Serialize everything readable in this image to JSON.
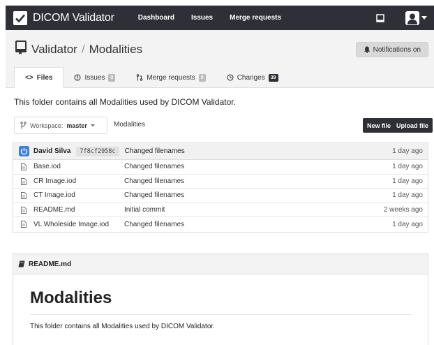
{
  "navbar": {
    "brand": "DICOM Validator",
    "links": [
      "Dashboard",
      "Issues",
      "Merge requests"
    ]
  },
  "header": {
    "breadcrumb": [
      "Validator",
      "Modalities"
    ],
    "separator": "/",
    "notifications_label": "Notifications on"
  },
  "tabs": [
    {
      "label": "Files",
      "count": "",
      "active": true
    },
    {
      "label": "Issues",
      "count": "0"
    },
    {
      "label": "Merge requests",
      "count": "0"
    },
    {
      "label": "Changes",
      "count": "39"
    }
  ],
  "folder": {
    "description": "This folder contains all Modalities used by DICOM Validator.",
    "workspace_label": "Workspace:",
    "branch": "master",
    "path": "Modalities",
    "new_file_label": "New file",
    "upload_file_label": "Upload file"
  },
  "last_commit": {
    "author": "David Silva",
    "sha": "7f8cf2958c",
    "message": "Changed filenames",
    "time": "1 day ago"
  },
  "files": [
    {
      "name": "Base.iod",
      "message": "Changed filenames",
      "time": "1 day ago"
    },
    {
      "name": "CR Image.iod",
      "message": "Changed filenames",
      "time": "1 day ago"
    },
    {
      "name": "CT Image.iod",
      "message": "Changed filenames",
      "time": "1 day ago"
    },
    {
      "name": "README.md",
      "message": "Initial commit",
      "time": "2 weeks ago"
    },
    {
      "name": "VL Wholeside Image.iod",
      "message": "Changed filenames",
      "time": "1 day ago"
    }
  ],
  "readme": {
    "filename": "README.md",
    "heading": "Modalities",
    "body": "This folder contains all Modalities used by DICOM Validator."
  },
  "colors": {
    "navbar": "#2f3037",
    "accent_avatar": "#3b7ddd"
  }
}
